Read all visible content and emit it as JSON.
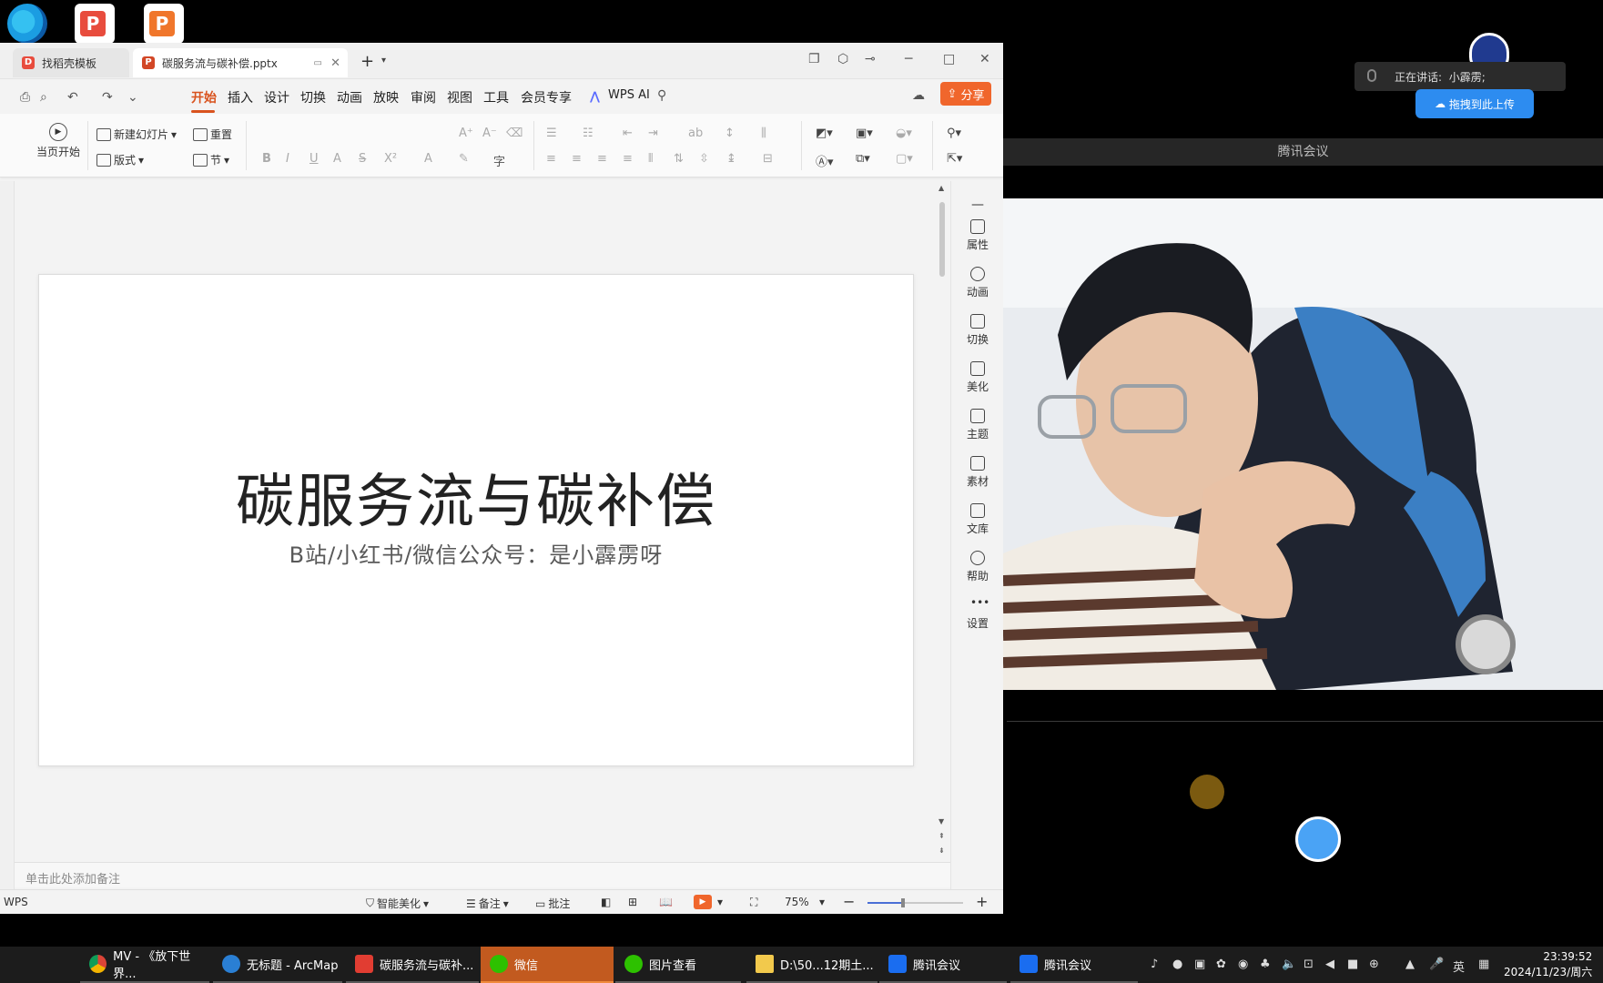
{
  "wps": {
    "tabs": [
      {
        "label": "找稻壳模板"
      },
      {
        "label": "碳服务流与碳补偿.pptx"
      }
    ],
    "menu": [
      "开始",
      "插入",
      "设计",
      "切换",
      "动画",
      "放映",
      "审阅",
      "视图",
      "工具",
      "会员专享"
    ],
    "wps_ai": "WPS AI",
    "share": "分享",
    "ribbon": {
      "from_current": "当页开始",
      "new_slide": "新建幻灯片",
      "reset": "重置",
      "layout": "版式",
      "section": "节"
    },
    "slide": {
      "title": "碳服务流与碳补偿",
      "subtitle": "B站/小红书/微信公众号：是小霹雳呀"
    },
    "notes_placeholder": "单击此处添加备注",
    "side_panel": [
      "属性",
      "动画",
      "切换",
      "美化",
      "主题",
      "素材",
      "文库",
      "帮助",
      "设置"
    ],
    "status": {
      "app": "WPS",
      "smart_beautify": "智能美化",
      "notes": "备注",
      "comments": "批注",
      "zoom": "75%",
      "zoom_level": 0.35
    }
  },
  "meeting": {
    "speaking_label": "正在讲话:",
    "speaker": "小霹雳;",
    "upload_label": "拖拽到此上传",
    "title": "腾讯会议"
  },
  "taskbar": {
    "items": [
      {
        "label": "MV - 《放下世界..."
      },
      {
        "label": "无标题 - ArcMap"
      },
      {
        "label": "碳服务流与碳补..."
      },
      {
        "label": "微信"
      },
      {
        "label": "图片查看"
      },
      {
        "label": "D:\\50...12期土..."
      },
      {
        "label": "腾讯会议"
      },
      {
        "label": "腾讯会议"
      }
    ],
    "ime": "英",
    "time": "23:39:52",
    "date": "2024/11/23/周六"
  },
  "colors": {
    "accent": "#d9531e",
    "share": "#f0662c",
    "taskbar": "#1c1c1c"
  }
}
